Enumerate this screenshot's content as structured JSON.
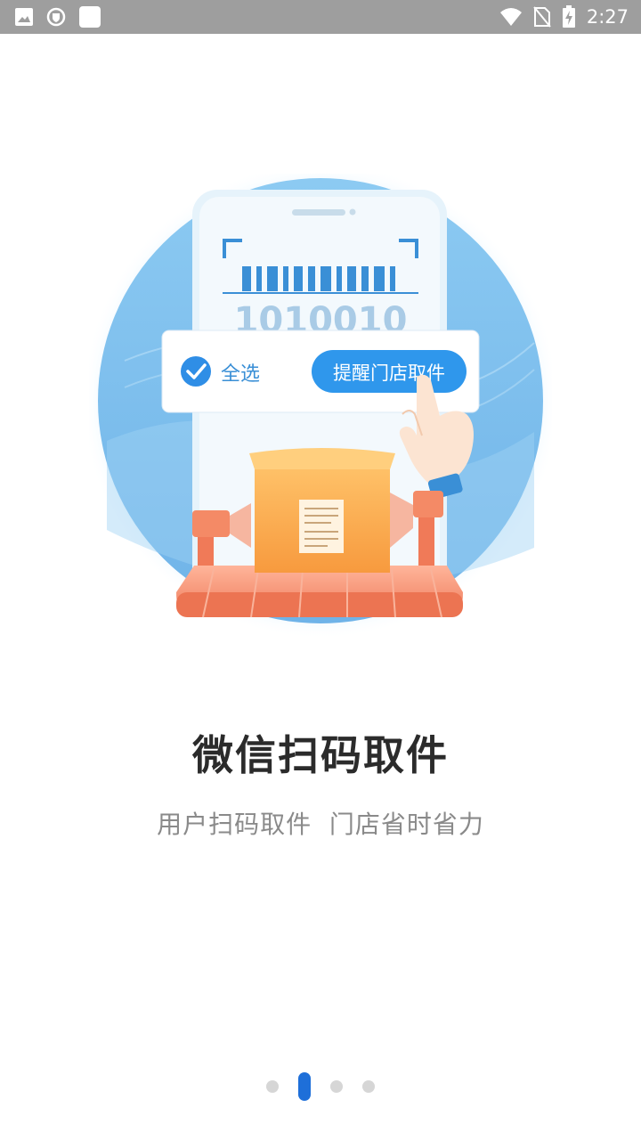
{
  "status_bar": {
    "time": "2:27",
    "icons": [
      "gallery-icon",
      "shield-icon",
      "app-square-icon",
      "wifi-icon",
      "no-sim-icon",
      "battery-charging-icon"
    ]
  },
  "illustration": {
    "barcode_text": "1010010",
    "select_all_label": "全选",
    "remind_button_label": "提醒门店取件"
  },
  "title": "微信扫码取件",
  "subtitle": "用户扫码取件  门店省时省力",
  "pager": {
    "total": 4,
    "active_index": 1
  },
  "colors": {
    "accent": "#1e6fd9",
    "button_blue": "#2f97ec",
    "circle_blue": "#7fc0ee",
    "box_orange": "#f7a04a",
    "conveyor": "#ef8a6a",
    "status_bar": "#9e9e9e"
  }
}
